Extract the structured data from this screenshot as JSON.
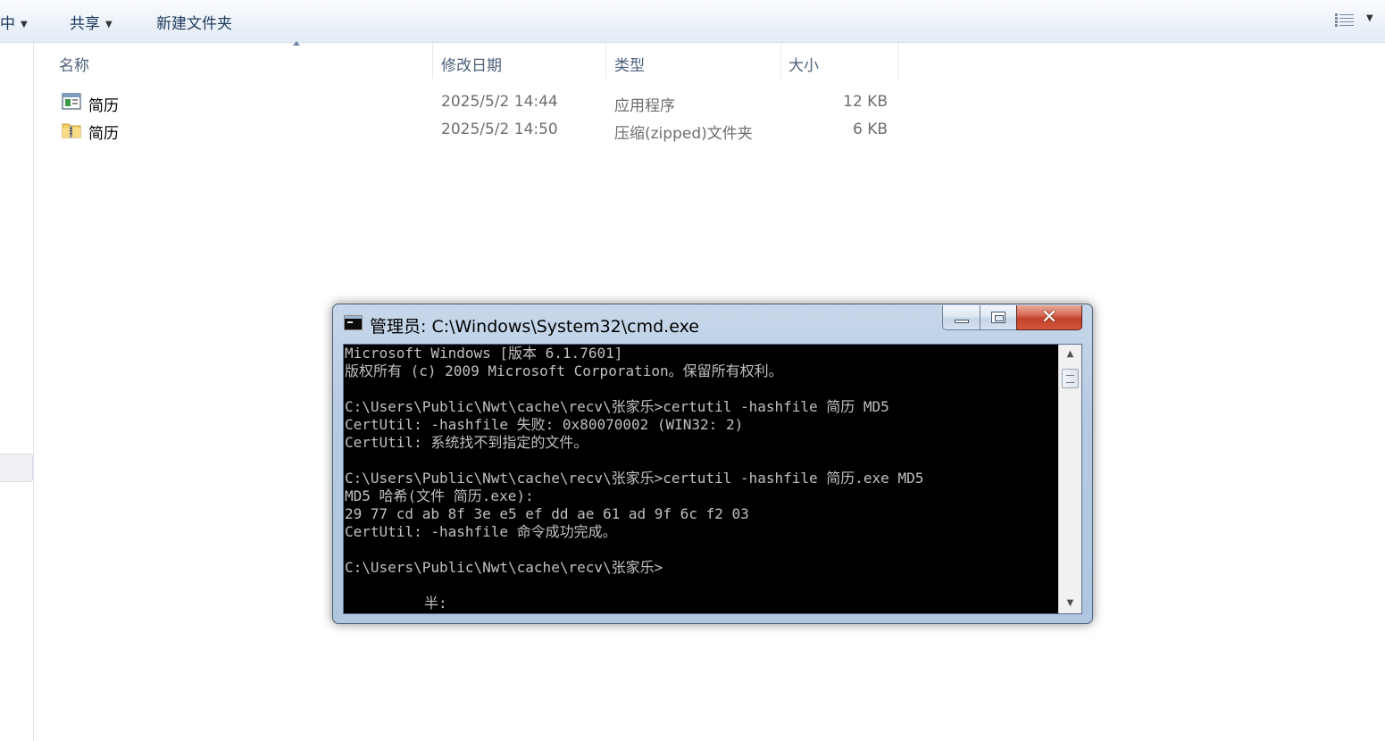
{
  "toolbar": {
    "organize_partial": "中",
    "share": "共享",
    "new_folder": "新建文件夹"
  },
  "columns": {
    "name": "名称",
    "date": "修改日期",
    "type": "类型",
    "size": "大小"
  },
  "files": [
    {
      "name": "简历",
      "date": "2025/5/2 14:44",
      "type": "应用程序",
      "size": "12 KB",
      "icon": "application-icon"
    },
    {
      "name": "简历",
      "date": "2025/5/2 14:50",
      "type": "压缩(zipped)文件夹",
      "size": "6 KB",
      "icon": "zip-folder-icon"
    }
  ],
  "cmd": {
    "title": "管理员: C:\\Windows\\System32\\cmd.exe",
    "lines": [
      "Microsoft Windows [版本 6.1.7601]",
      "版权所有 (c) 2009 Microsoft Corporation。保留所有权利。",
      "",
      "C:\\Users\\Public\\Nwt\\cache\\recv\\张家乐>certutil -hashfile 简历 MD5",
      "CertUtil: -hashfile 失败: 0x80070002 (WIN32: 2)",
      "CertUtil: 系统找不到指定的文件。",
      "",
      "C:\\Users\\Public\\Nwt\\cache\\recv\\张家乐>certutil -hashfile 简历.exe MD5",
      "MD5 哈希(文件 简历.exe):",
      "29 77 cd ab 8f 3e e5 ef dd ae 61 ad 9f 6c f2 03",
      "CertUtil: -hashfile 命令成功完成。",
      "",
      "C:\\Users\\Public\\Nwt\\cache\\recv\\张家乐>"
    ],
    "ime_status": "半:"
  },
  "colors": {
    "console_bg": "#000000",
    "console_fg": "#c0c0c0",
    "close_red": "#c2402a",
    "window_frame": "#b5cbe3"
  }
}
